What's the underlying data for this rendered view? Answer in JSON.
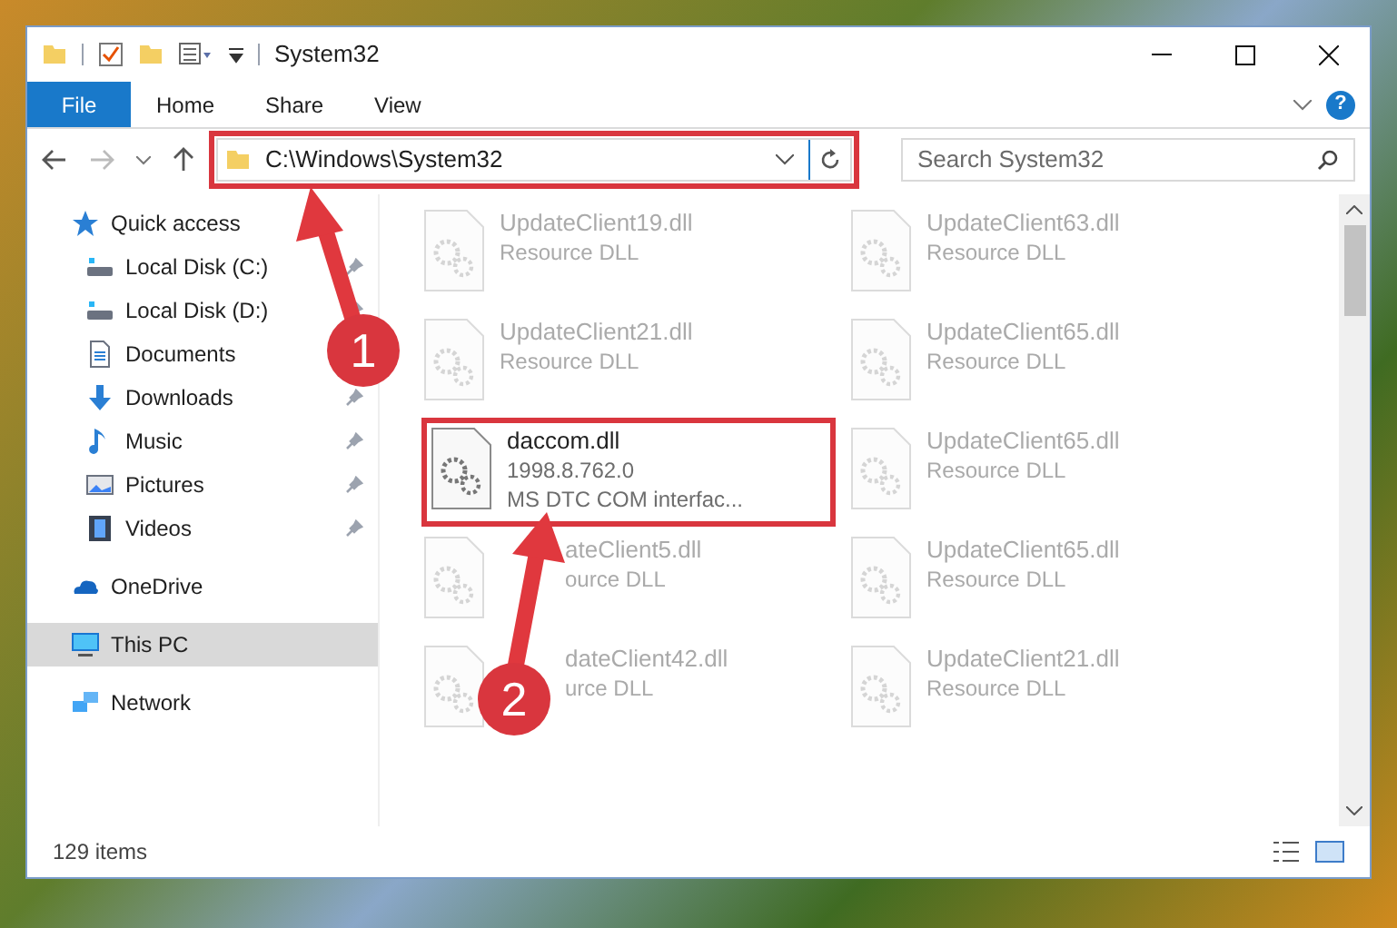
{
  "window": {
    "title": "System32"
  },
  "ribbon_tabs": [
    {
      "label": "File",
      "kind": "file"
    },
    {
      "label": "Home",
      "kind": "tab"
    },
    {
      "label": "Share",
      "kind": "tab"
    },
    {
      "label": "View",
      "kind": "tab"
    }
  ],
  "help_button": {
    "label": "?"
  },
  "address": {
    "path": "C:\\Windows\\System32",
    "highlighted": true
  },
  "search": {
    "placeholder": "Search System32"
  },
  "sidebar": {
    "items": [
      {
        "label": "Quick access",
        "selected": false,
        "children": [
          {
            "label": "Local Disk (C:)",
            "pinned": true
          },
          {
            "label": "Local Disk (D:)",
            "pinned": true
          },
          {
            "label": "Documents",
            "pinned": false
          },
          {
            "label": "Downloads",
            "pinned": true
          },
          {
            "label": "Music",
            "pinned": true
          },
          {
            "label": "Pictures",
            "pinned": true
          },
          {
            "label": "Videos",
            "pinned": true
          }
        ]
      },
      {
        "label": "OneDrive",
        "selected": false
      },
      {
        "label": "This PC",
        "selected": true
      },
      {
        "label": "Network",
        "selected": false
      }
    ]
  },
  "files": [
    {
      "name": "UpdateClient19.dll",
      "details": [
        "Resource DLL"
      ],
      "faded": true
    },
    {
      "name": "UpdateClient63.dll",
      "details": [
        "Resource DLL"
      ],
      "faded": true
    },
    {
      "name": "UpdateClient21.dll",
      "details": [
        "Resource DLL"
      ],
      "faded": true
    },
    {
      "name": "UpdateClient65.dll",
      "details": [
        "Resource DLL"
      ],
      "faded": true
    },
    {
      "name": "daccom.dll",
      "details": [
        "1998.8.762.0",
        "MS DTC COM interfac..."
      ],
      "faded": false,
      "highlighted": true
    },
    {
      "name": "UpdateClient65.dll",
      "details": [
        "Resource DLL"
      ],
      "faded": true
    },
    {
      "name": "ateClient5.dll",
      "details": [
        "ource DLL"
      ],
      "faded": true,
      "covered": true
    },
    {
      "name": "UpdateClient65.dll",
      "details": [
        "Resource DLL"
      ],
      "faded": true
    },
    {
      "name": "dateClient42.dll",
      "details": [
        "urce DLL"
      ],
      "faded": true,
      "covered": true
    },
    {
      "name": "UpdateClient21.dll",
      "details": [
        "Resource DLL"
      ],
      "faded": true
    }
  ],
  "status_bar": {
    "count": "129 items"
  },
  "annotations": [
    {
      "label": "1"
    },
    {
      "label": "2"
    }
  ]
}
